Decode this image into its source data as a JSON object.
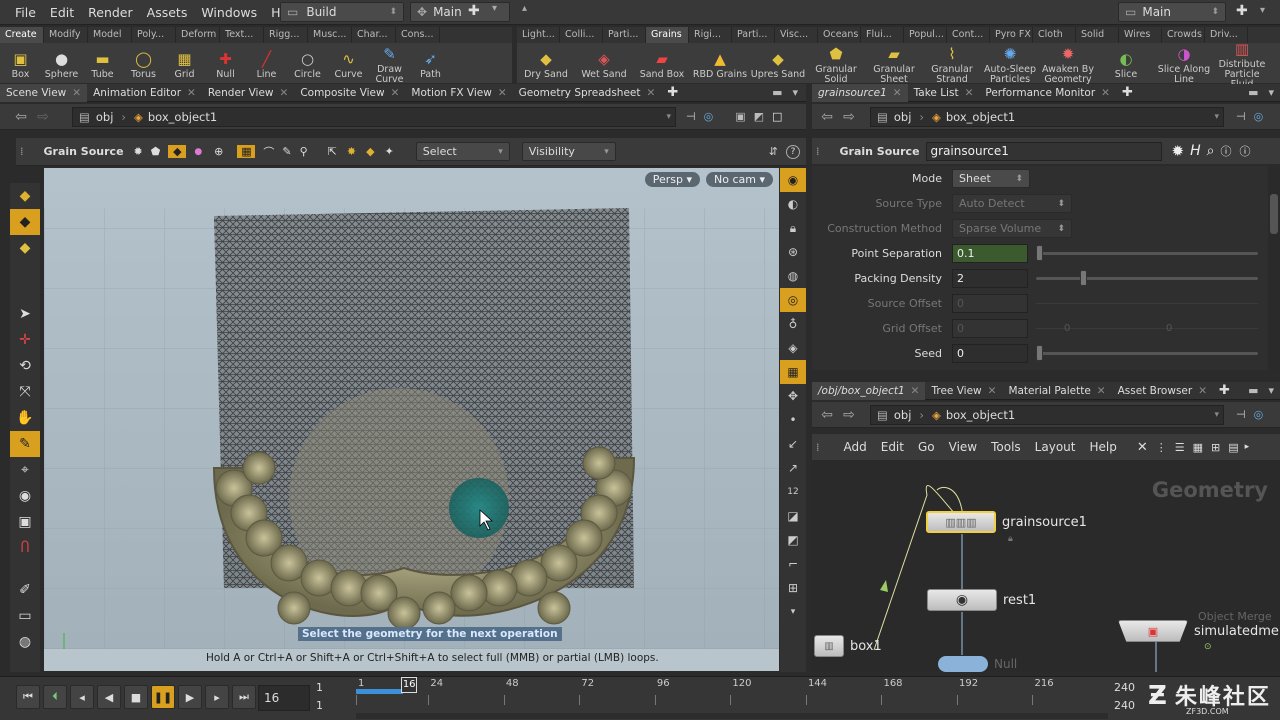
{
  "menu": {
    "items": [
      "File",
      "Edit",
      "Render",
      "Assets",
      "Windows",
      "Help"
    ],
    "desktop": "Build",
    "ui_mode": "Main",
    "right_desktop": "Main"
  },
  "shelf_left": {
    "tabs": [
      "Create",
      "Modify",
      "Model",
      "Poly...",
      "Deform",
      "Text...",
      "Rigg...",
      "Musc...",
      "Char...",
      "Cons..."
    ],
    "active_tab": "Create",
    "tools": [
      {
        "label": "Box",
        "icon": "box-icon"
      },
      {
        "label": "Sphere",
        "icon": "sphere-icon"
      },
      {
        "label": "Tube",
        "icon": "tube-icon"
      },
      {
        "label": "Torus",
        "icon": "torus-icon"
      },
      {
        "label": "Grid",
        "icon": "grid-icon"
      },
      {
        "label": "Null",
        "icon": "null-icon"
      },
      {
        "label": "Line",
        "icon": "line-icon"
      },
      {
        "label": "Circle",
        "icon": "circle-icon"
      },
      {
        "label": "Curve",
        "icon": "curve-icon"
      },
      {
        "label": "Draw Curve",
        "icon": "draw-curve-icon"
      },
      {
        "label": "Path",
        "icon": "path-icon"
      }
    ]
  },
  "shelf_right": {
    "tabs": [
      "Light...",
      "Colli...",
      "Parti...",
      "Grains",
      "Rigi...",
      "Parti...",
      "Visc...",
      "Oceans",
      "Flui...",
      "Popul...",
      "Cont...",
      "Pyro FX",
      "Cloth",
      "Solid",
      "Wires",
      "Crowds",
      "Driv..."
    ],
    "active_tab": "Grains",
    "tools": [
      {
        "label": "Dry Sand",
        "icon": "dry-sand-icon"
      },
      {
        "label": "Wet Sand",
        "icon": "wet-sand-icon"
      },
      {
        "label": "Sand Box",
        "icon": "sand-box-icon"
      },
      {
        "label": "RBD Grains",
        "icon": "rbd-grains-icon"
      },
      {
        "label": "Upres Sand",
        "icon": "upres-sand-icon"
      },
      {
        "label": "Granular Solid",
        "icon": "granular-solid-icon"
      },
      {
        "label": "Granular Sheet",
        "icon": "granular-sheet-icon"
      },
      {
        "label": "Granular Strand",
        "icon": "granular-strand-icon"
      },
      {
        "label": "Auto-Sleep Particles",
        "icon": "auto-sleep-icon"
      },
      {
        "label": "Awaken By Geometry",
        "icon": "awaken-icon"
      },
      {
        "label": "Slice",
        "icon": "slice-icon"
      },
      {
        "label": "Slice Along Line",
        "icon": "slice-line-icon"
      },
      {
        "label": "Distribute Particle Fluid",
        "icon": "distribute-fluid-icon"
      }
    ]
  },
  "left_pane": {
    "tabs": [
      "Scene View",
      "Animation Editor",
      "Render View",
      "Composite View",
      "Motion FX View",
      "Geometry Spreadsheet"
    ],
    "active_tab": "Scene View",
    "path": [
      "obj",
      "box_object1"
    ],
    "operation": "Grain Source",
    "select_mode": "Select",
    "visibility": "Visibility",
    "persp": "Persp",
    "cam": "No cam",
    "prompt": "Select the geometry for the next operation",
    "hint": "Hold A or Ctrl+A or Shift+A or Ctrl+Shift+A to select full (MMB) or partial (LMB) loops."
  },
  "parm_pane": {
    "tabs": [
      "grainsource1",
      "Take List",
      "Performance Monitor"
    ],
    "active_tab": "grainsource1",
    "path": [
      "obj",
      "box_object1"
    ],
    "node_type": "Grain Source",
    "node_name": "grainsource1",
    "parms": [
      {
        "label": "Mode",
        "value": "Sheet",
        "kind": "menu",
        "enabled": true
      },
      {
        "label": "Source Type",
        "value": "Auto Detect",
        "kind": "menu",
        "enabled": false
      },
      {
        "label": "Construction Method",
        "value": "Sparse Volume",
        "kind": "menu",
        "enabled": false
      },
      {
        "label": "Point Separation",
        "value": "0.1",
        "kind": "float",
        "enabled": true,
        "slider": 0.0
      },
      {
        "label": "Packing Density",
        "value": "2",
        "kind": "float",
        "enabled": true,
        "slider": 0.2
      },
      {
        "label": "Source Offset",
        "value": "0",
        "kind": "vec",
        "enabled": false
      },
      {
        "label": "Grid Offset",
        "value": "0",
        "kind": "vec3",
        "enabled": false,
        "extra": [
          "0",
          "0"
        ]
      },
      {
        "label": "Seed",
        "value": "0",
        "kind": "int",
        "enabled": true,
        "slider": 0.0
      }
    ]
  },
  "network_pane": {
    "tabs": [
      "/obj/box_object1",
      "Tree View",
      "Material Palette",
      "Asset Browser"
    ],
    "active_tab": "/obj/box_object1",
    "path": [
      "obj",
      "box_object1"
    ],
    "menu": [
      "Add",
      "Edit",
      "Go",
      "View",
      "Tools",
      "Layout",
      "Help"
    ],
    "context": "Geometry",
    "nodes": [
      {
        "name": "grainsource1",
        "selected": true
      },
      {
        "name": "rest1"
      },
      {
        "name": "box1"
      },
      {
        "name": "Null"
      },
      {
        "name": "simulatedme",
        "type_label": "Object Merge"
      }
    ]
  },
  "timeline": {
    "current_frame": "16",
    "start": "1",
    "start2": "1",
    "end": "240",
    "end2": "240",
    "ticks": [
      "1",
      "24",
      "48",
      "72",
      "96",
      "120",
      "144",
      "168",
      "192",
      "216"
    ],
    "playhead": "16",
    "progress": 0.063
  },
  "watermark": {
    "text": "朱峰社区",
    "sub": "ZF3D.COM"
  }
}
